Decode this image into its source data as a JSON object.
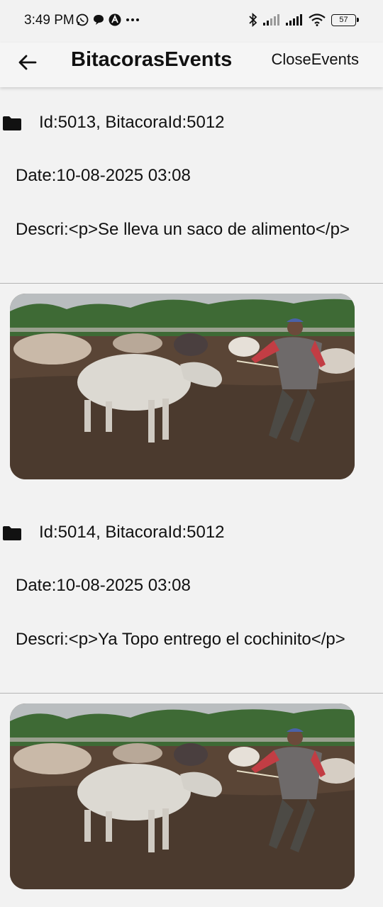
{
  "status": {
    "time": "3:49 PM",
    "battery": "57"
  },
  "appbar": {
    "title": "BitacorasEvents",
    "action_label": "CloseEvents"
  },
  "events": [
    {
      "ids": "Id:5013, BitacoraId:5012",
      "date": "Date:10-08-2025 03:08",
      "description": "Descri:<p>Se lleva un saco de alimento</p>"
    },
    {
      "ids": "Id:5014, BitacoraId:5012",
      "date": "Date:10-08-2025 03:08",
      "description": "Descri:<p>Ya Topo entrego el cochinito</p>"
    }
  ],
  "icons": {
    "back": "arrow-left-icon",
    "folder": "folder-icon"
  },
  "colors": {
    "background": "#f2f2f2",
    "divider": "#b5b5b5"
  }
}
